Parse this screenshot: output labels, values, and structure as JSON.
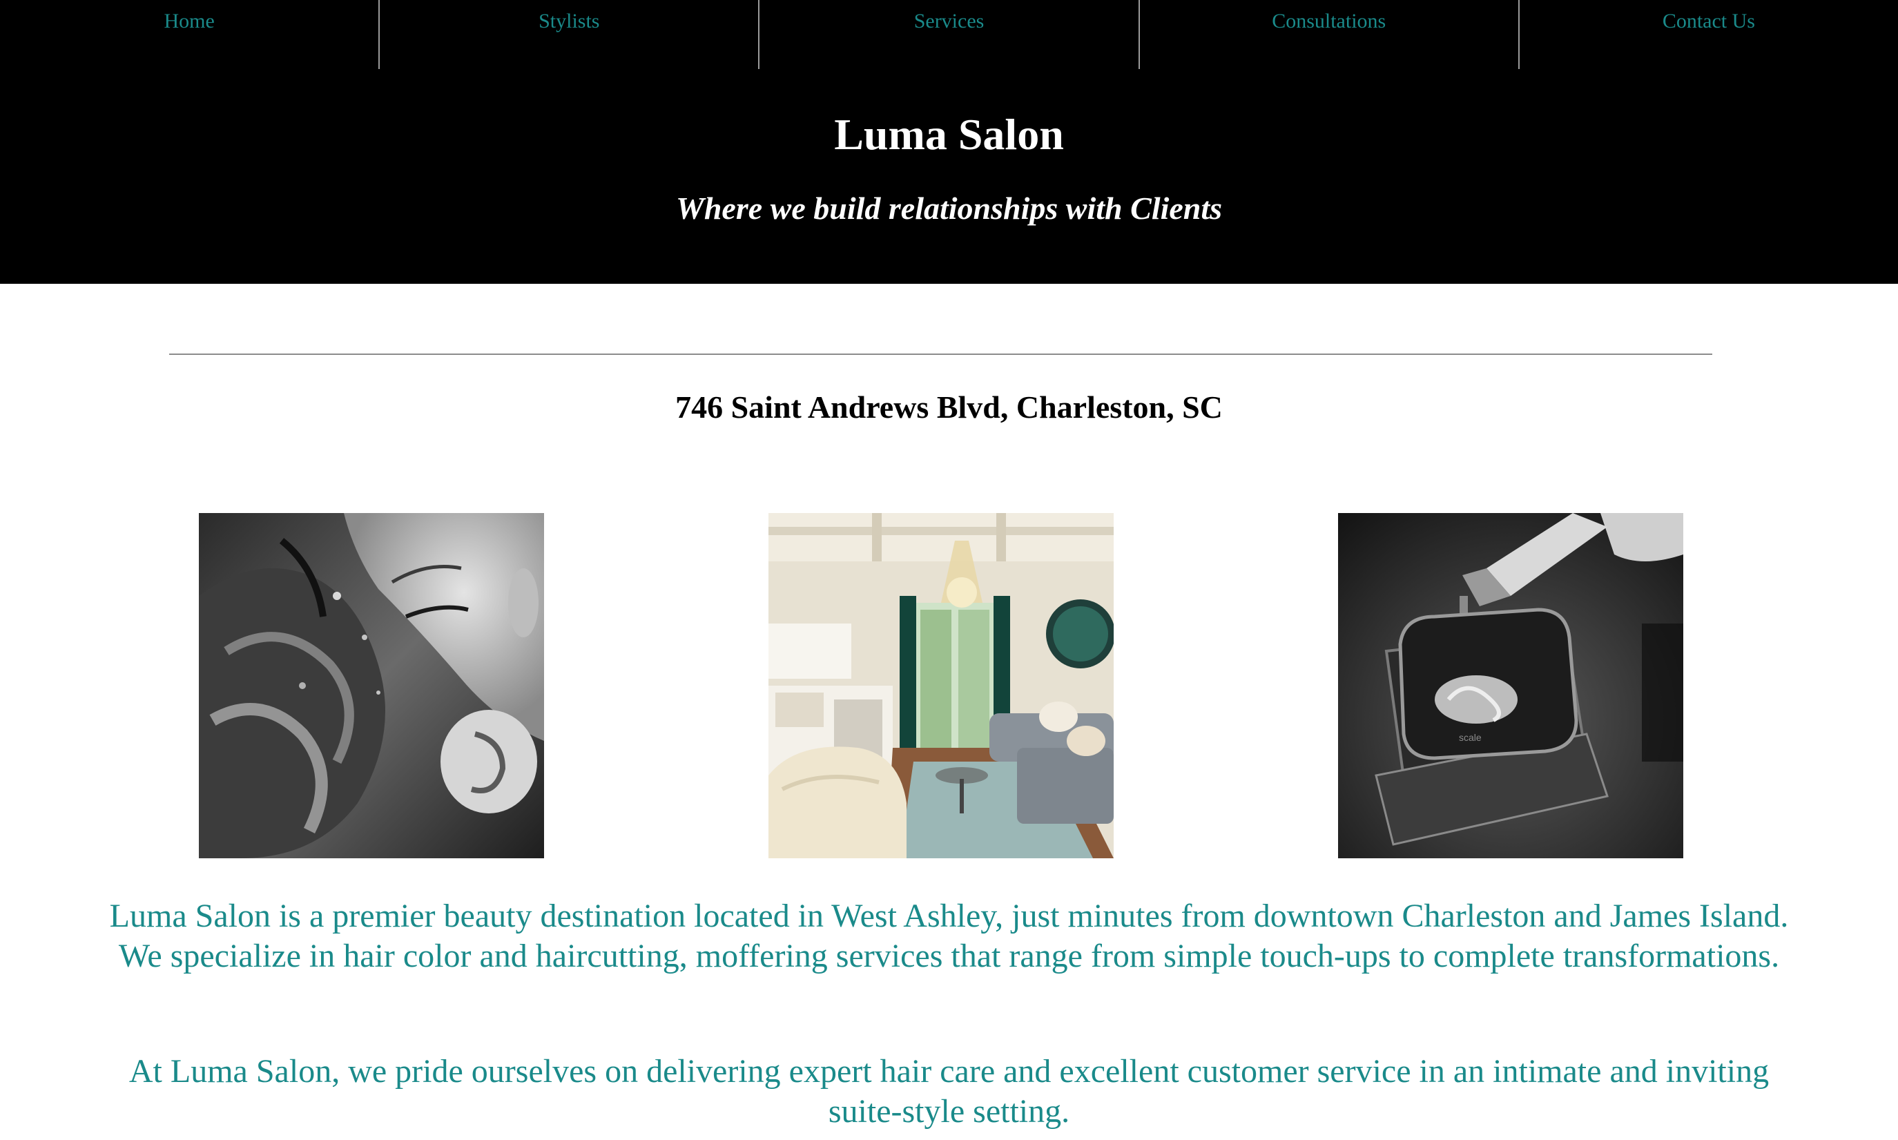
{
  "nav": {
    "items": [
      {
        "label": "Home"
      },
      {
        "label": "Stylists"
      },
      {
        "label": "Services"
      },
      {
        "label": "Consultations"
      },
      {
        "label": "Contact Us"
      }
    ]
  },
  "header": {
    "title": "Luma Salon",
    "tagline": "Where we build relationships with Clients"
  },
  "address": "746 Saint Andrews Blvd, Charleston, SC",
  "photos": [
    {
      "name": "hair-washing-photo",
      "style": "black-and-white"
    },
    {
      "name": "salon-suite-interior-photo",
      "style": "color"
    },
    {
      "name": "hair-color-mixing-photo",
      "style": "black-and-white"
    }
  ],
  "content": {
    "intro": "Luma Salon is a premier beauty destination located in West Ashley, just minutes from downtown Charleston and James Island. We specialize in hair color and haircutting, moffering services that range from simple touch-ups to complete transformations.",
    "intro2": "At Luma Salon, we pride ourselves on delivering expert hair care and excellent customer service in an intimate and inviting suite-style setting."
  },
  "colors": {
    "accent": "#1a8a8a",
    "header_bg": "#000000",
    "header_text": "#ffffff"
  }
}
